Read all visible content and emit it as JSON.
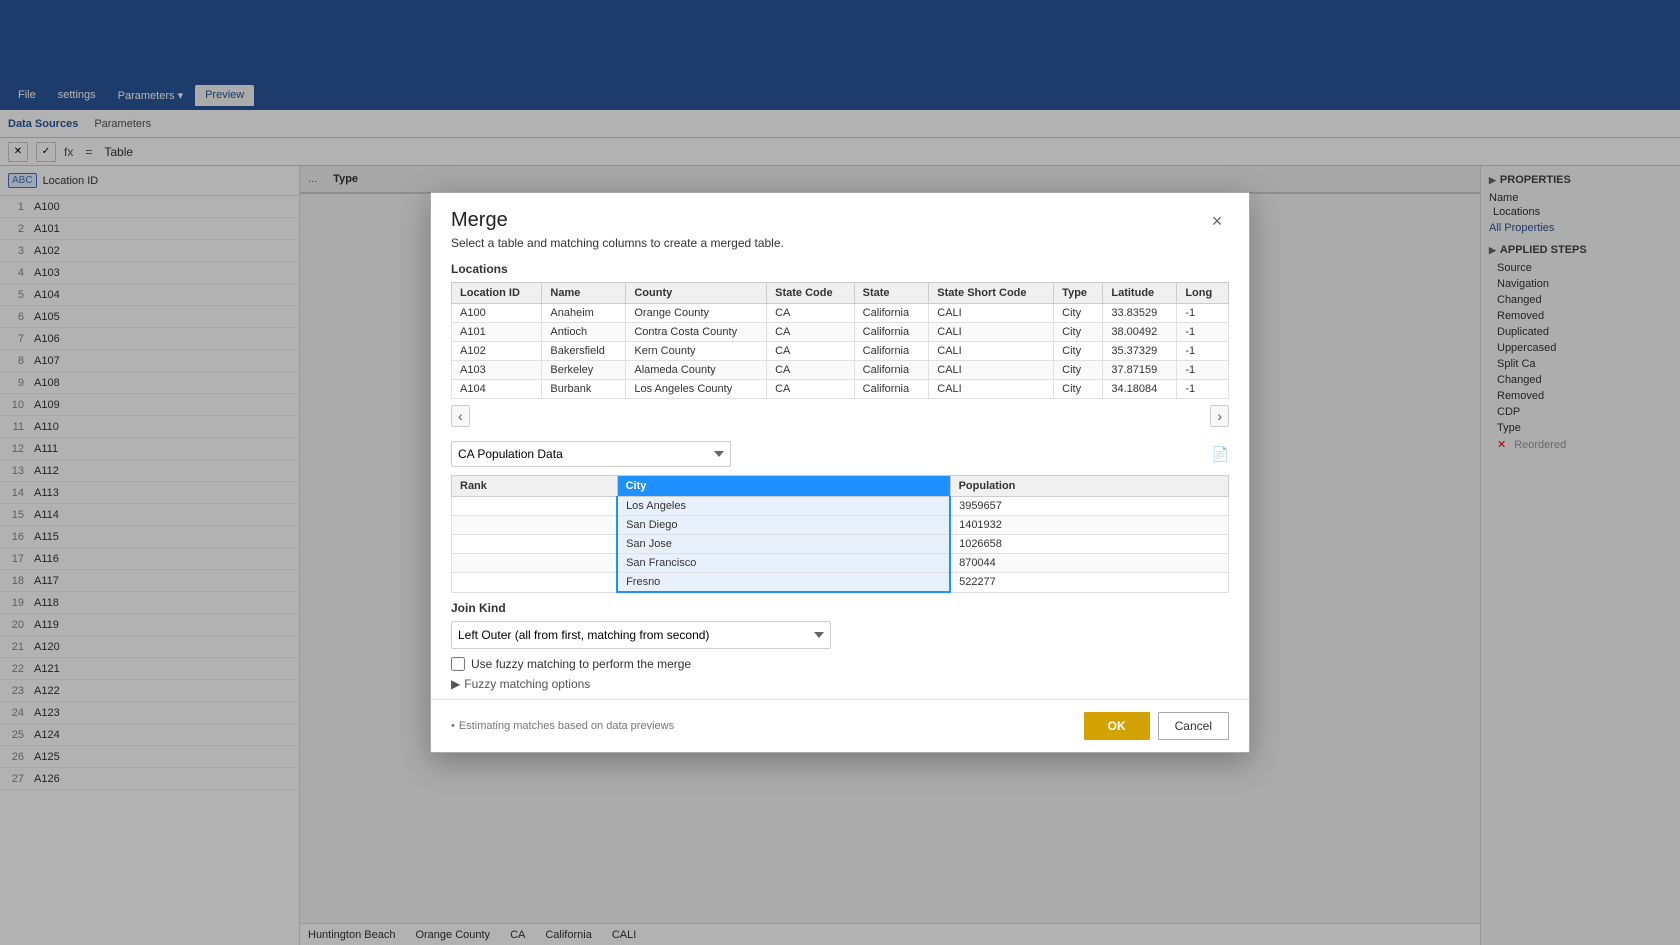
{
  "ribbon": {
    "tabs": [
      "File",
      "settings",
      "Parameters",
      "Preview"
    ],
    "active_tab": "Preview"
  },
  "formula_bar": {
    "icon": "Table",
    "equation": "=",
    "content": "Table"
  },
  "left_panel": {
    "column_header": "Location ID",
    "column_type": "ABC",
    "rows": [
      {
        "num": 1,
        "val": "A100"
      },
      {
        "num": 2,
        "val": "A101"
      },
      {
        "num": 3,
        "val": "A102"
      },
      {
        "num": 4,
        "val": "A103"
      },
      {
        "num": 5,
        "val": "A104"
      },
      {
        "num": 6,
        "val": "A105"
      },
      {
        "num": 7,
        "val": "A106"
      },
      {
        "num": 8,
        "val": "A107"
      },
      {
        "num": 9,
        "val": "A108"
      },
      {
        "num": 10,
        "val": "A109"
      },
      {
        "num": 11,
        "val": "A110"
      },
      {
        "num": 12,
        "val": "A111"
      },
      {
        "num": 13,
        "val": "A112"
      },
      {
        "num": 14,
        "val": "A113"
      },
      {
        "num": 15,
        "val": "A114"
      },
      {
        "num": 16,
        "val": "A115"
      },
      {
        "num": 17,
        "val": "A116"
      },
      {
        "num": 18,
        "val": "A117"
      },
      {
        "num": 19,
        "val": "A118"
      },
      {
        "num": 20,
        "val": "A119"
      },
      {
        "num": 21,
        "val": "A120"
      },
      {
        "num": 22,
        "val": "A121"
      },
      {
        "num": 23,
        "val": "A122"
      },
      {
        "num": 24,
        "val": "A123"
      },
      {
        "num": 25,
        "val": "A124"
      },
      {
        "num": 26,
        "val": "A125"
      },
      {
        "num": 27,
        "val": "A126"
      }
    ]
  },
  "right_panel": {
    "properties_title": "PROPERTIES",
    "name_label": "Name",
    "name_value": "Locations",
    "all_properties_link": "All Properties",
    "applied_steps_title": "APPLIED STEPS",
    "steps": [
      {
        "label": "Source",
        "active": false,
        "crossed": false
      },
      {
        "label": "Navigation",
        "active": false,
        "crossed": false
      },
      {
        "label": "Changed",
        "active": false,
        "crossed": false
      },
      {
        "label": "Removed",
        "active": false,
        "crossed": false
      },
      {
        "label": "Duplicated",
        "active": false,
        "crossed": false
      },
      {
        "label": "Uppercased",
        "active": false,
        "crossed": false
      },
      {
        "label": "Split Ca",
        "active": false,
        "crossed": false
      },
      {
        "label": "Changed",
        "active": false,
        "crossed": false
      },
      {
        "label": "Removed",
        "active": false,
        "crossed": false
      },
      {
        "label": "CDP",
        "active": false,
        "crossed": false
      },
      {
        "label": "Type",
        "active": false,
        "crossed": false
      },
      {
        "label": "Reordered",
        "active": false,
        "crossed": true
      }
    ]
  },
  "dialog": {
    "title": "Merge",
    "subtitle": "Select a table and matching columns to create a merged table.",
    "close_label": "×",
    "first_table": {
      "label": "Locations",
      "columns": [
        "Location ID",
        "Name",
        "County",
        "State Code",
        "State",
        "State Short Code",
        "Type",
        "Latitude",
        "Long"
      ],
      "rows": [
        {
          "id": "A100",
          "name": "Anaheim",
          "county": "Orange County",
          "state_code": "CA",
          "state": "California",
          "short": "CALI",
          "type": "City",
          "lat": "33.83529",
          "long": "-1"
        },
        {
          "id": "A101",
          "name": "Antioch",
          "county": "Contra Costa County",
          "state_code": "CA",
          "state": "California",
          "short": "CALI",
          "type": "City",
          "lat": "38.00492",
          "long": "-1"
        },
        {
          "id": "A102",
          "name": "Bakersfield",
          "county": "Kern County",
          "state_code": "CA",
          "state": "California",
          "short": "CALI",
          "type": "City",
          "lat": "35.37329",
          "long": "-1"
        },
        {
          "id": "A103",
          "name": "Berkeley",
          "county": "Alameda County",
          "state_code": "CA",
          "state": "California",
          "short": "CALI",
          "type": "City",
          "lat": "37.87159",
          "long": "-1"
        },
        {
          "id": "A104",
          "name": "Burbank",
          "county": "Los Angeles County",
          "state_code": "CA",
          "state": "California",
          "short": "CALI",
          "type": "City",
          "lat": "34.18084",
          "long": "-1"
        }
      ]
    },
    "second_table": {
      "dropdown_value": "CA Population Data",
      "columns": [
        "Rank",
        "City",
        "Population"
      ],
      "selected_column": "City",
      "rows": [
        {
          "rank": "",
          "city": "Los Angeles",
          "pop": "3959657"
        },
        {
          "rank": "",
          "city": "San Diego",
          "pop": "1401932"
        },
        {
          "rank": "",
          "city": "San Jose",
          "pop": "1026658"
        },
        {
          "rank": "",
          "city": "San Francisco",
          "pop": "870044"
        },
        {
          "rank": "",
          "city": "Fresno",
          "pop": "522277"
        }
      ]
    },
    "join_kind": {
      "label": "Join Kind",
      "value": "Left Outer (all from first, matching from second)"
    },
    "fuzzy": {
      "label": "Use fuzzy matching to perform the merge",
      "checked": false
    },
    "fuzzy_options": {
      "label": "Fuzzy matching options"
    },
    "footer_note": "Estimating matches based on data previews",
    "ok_label": "OK",
    "cancel_label": "Cancel"
  },
  "background_visible": {
    "bottom_row_label": "Huntington Beach",
    "bottom_county": "Orange County",
    "bottom_state": "CA",
    "bottom_state_full": "California",
    "bottom_short": "CALI",
    "col_type_label": "Type",
    "source_label": "Source",
    "split_ca_label": "Split Ca",
    "city_label": "City"
  }
}
